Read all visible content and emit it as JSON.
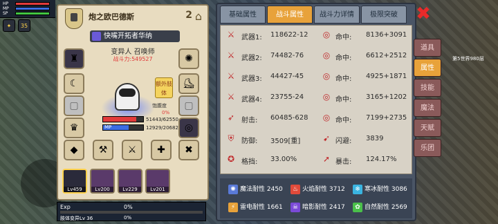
{
  "hud": {
    "labels": [
      "HP",
      "MP",
      "SP"
    ],
    "coin_text": "35"
  },
  "character": {
    "name": "炮之欧巴德斯",
    "rank": "2",
    "guild": "快嘴开拓者华纳",
    "job": "变异人 召唤师",
    "power_text": "战斗力:549527",
    "extra_button": "额外肢体",
    "satiety_label": "饱腹度",
    "satiety_value": "0%",
    "hp_text": "51443/62550",
    "mp_label": "MP",
    "mp_text": "12929/20682",
    "hp_fraction": 0.82,
    "mp_fraction": 0.63
  },
  "team": [
    {
      "level": "Lv459",
      "selected": true
    },
    {
      "level": "Lv200"
    },
    {
      "level": "Lv229"
    },
    {
      "level": "Lv201"
    }
  ],
  "exp": {
    "label": "Exp",
    "value": "0%",
    "sub_label": "肢体变异Lv 36",
    "sub_value": "0%"
  },
  "tabs": [
    "基础属性",
    "战斗属性",
    "战斗力详情",
    "极限突破"
  ],
  "active_tab": 1,
  "stats": [
    {
      "left_icon": "sword-icon",
      "left_label": "武器1:",
      "left_value": "118622-12",
      "right_icon": "target-icon",
      "right_label": "命中:",
      "right_value": "8136+3091"
    },
    {
      "left_icon": "sword-icon",
      "left_label": "武器2:",
      "left_value": "74482-76",
      "right_icon": "target-icon",
      "right_label": "命中:",
      "right_value": "6612+2512"
    },
    {
      "left_icon": "sword-icon",
      "left_label": "武器3:",
      "left_value": "44427-45",
      "right_icon": "target-icon",
      "right_label": "命中:",
      "right_value": "4925+1871"
    },
    {
      "left_icon": "sword-icon",
      "left_label": "武器4:",
      "left_value": "23755-24",
      "right_icon": "target-icon",
      "right_label": "命中:",
      "right_value": "3165+1202"
    },
    {
      "left_icon": "bow-icon",
      "left_label": "射击:",
      "left_value": "60485-628",
      "right_icon": "target-icon",
      "right_label": "命中:",
      "right_value": "7199+2735"
    },
    {
      "left_icon": "shield-icon",
      "left_label": "防御:",
      "left_value": "3509[重]",
      "right_icon": "dodge-icon",
      "right_label": "闪避:",
      "right_value": "3839"
    },
    {
      "left_icon": "block-icon",
      "left_label": "格挡:",
      "left_value": "33.00%",
      "right_icon": "crit-icon",
      "right_label": "暴击:",
      "right_value": "124.17%"
    }
  ],
  "resists": [
    {
      "icon": "magic-resist-icon",
      "color": "#5a7ad8",
      "label": "魔法耐性 2450"
    },
    {
      "icon": "fire-resist-icon",
      "color": "#e04a3a",
      "label": "火焰耐性 3712"
    },
    {
      "icon": "ice-resist-icon",
      "color": "#3ab4e0",
      "label": "寒冰耐性 3086"
    },
    {
      "icon": "thunder-resist-icon",
      "color": "#e8a23a",
      "label": "雷电耐性 1661"
    },
    {
      "icon": "dark-resist-icon",
      "color": "#7a4ad8",
      "label": "暗影耐性 2417"
    },
    {
      "icon": "nature-resist-icon",
      "color": "#4ac04a",
      "label": "自然耐性 2569"
    }
  ],
  "side_menu": [
    "道具",
    "属性",
    "技能",
    "魔法",
    "天赋",
    "乐团"
  ],
  "side_active": 1,
  "world_label": "第5世界980层"
}
